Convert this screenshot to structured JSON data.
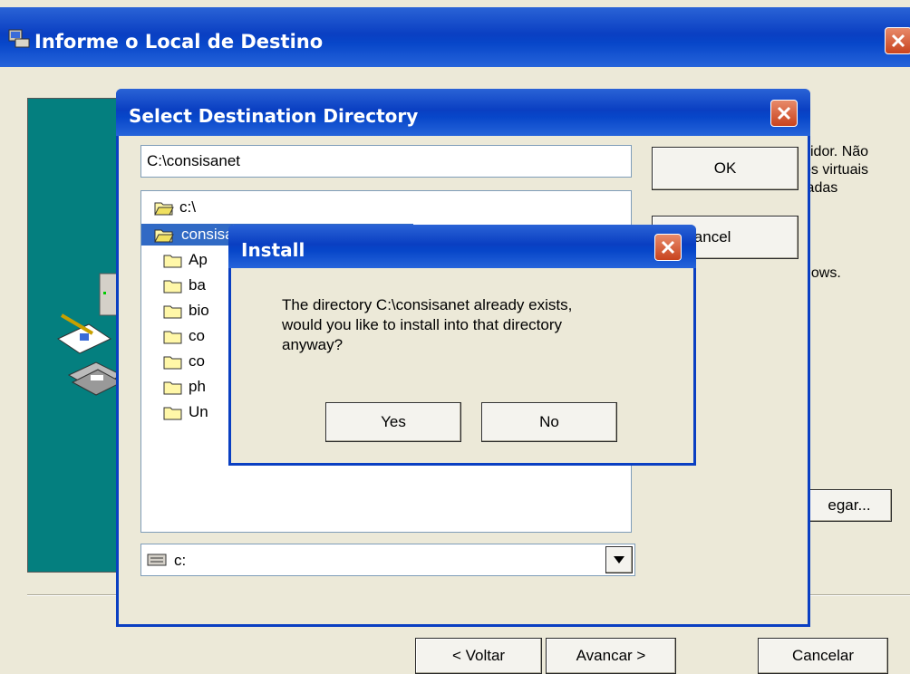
{
  "main_window": {
    "title": "Informe o Local de Destino",
    "right_text_lines": [
      "vidor. Não",
      "os virtuais",
      "iadas",
      "",
      "dows."
    ],
    "browse_button_label": "egar...",
    "back_button_label": "< Voltar",
    "next_button_label": "Avancar >",
    "cancel_button_label": "Cancelar"
  },
  "select_dir_dialog": {
    "title": "Select Destination Directory",
    "path_value": "C:\\consisanet",
    "ok_label": "OK",
    "cancel_label": "Cancel",
    "tree": [
      {
        "label": "c:\\",
        "open": true
      },
      {
        "label": "consisanet",
        "open": true,
        "selected": true
      },
      {
        "label": "Ap",
        "open": false
      },
      {
        "label": "ba",
        "open": false
      },
      {
        "label": "bio",
        "open": false
      },
      {
        "label": "co",
        "open": false
      },
      {
        "label": "co",
        "open": false
      },
      {
        "label": "ph",
        "open": false
      },
      {
        "label": "Un",
        "open": false
      }
    ],
    "drive_value": "c:"
  },
  "install_dialog": {
    "title": "Install",
    "message_lines": [
      "The directory C:\\consisanet already exists,",
      "would you like to install into that directory",
      "anyway?"
    ],
    "yes_label": "Yes",
    "no_label": "No"
  },
  "colors": {
    "teal_panel": "#047f7f",
    "selection": "#316ac5",
    "dialog_face": "#ece9d8"
  }
}
